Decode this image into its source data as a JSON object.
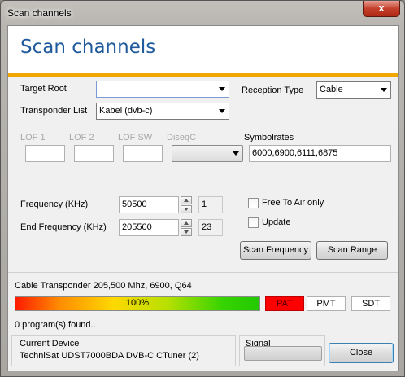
{
  "window": {
    "title": "Scan channels",
    "close_glyph": "x"
  },
  "header": {
    "title": "Scan channels",
    "accent_color": "#f2a700",
    "title_color": "#1e5a9c"
  },
  "form": {
    "target_root_label": "Target Root",
    "target_root_value": "",
    "transponder_list_label": "Transponder List",
    "transponder_list_value": "Kabel (dvb-c)",
    "reception_type_label": "Reception Type",
    "reception_type_value": "Cable",
    "lof1_label": "LOF 1",
    "lof2_label": "LOF 2",
    "lofsw_label": "LOF SW",
    "diseqc_label": "DiseqC",
    "symbolrates_label": "Symbolrates",
    "symbolrates_value": "6000,6900,6111,6875",
    "frequency_label": "Frequency (KHz)",
    "frequency_value": "50500",
    "frequency_step": "1",
    "end_frequency_label": "End  Frequency (KHz)",
    "end_frequency_value": "205500",
    "end_frequency_step": "23",
    "free_to_air_label": "Free To Air only",
    "update_label": "Update",
    "scan_frequency_button": "Scan Frequency",
    "scan_range_button": "Scan Range"
  },
  "status": {
    "transponder_text": "Cable Transponder 205,500 Mhz, 6900, Q64",
    "progress_text": "100%",
    "progress_value": 1.0,
    "pat_label": "PAT",
    "pmt_label": "PMT",
    "sdt_label": "SDT",
    "programs_found": "0 program(s) found.."
  },
  "footer": {
    "current_device_label": "Current Device",
    "current_device_value": "TechniSat UDST7000BDA DVB-C CTuner (2)",
    "signal_label": "Signal",
    "signal_level": 0,
    "close_button": "Close"
  }
}
